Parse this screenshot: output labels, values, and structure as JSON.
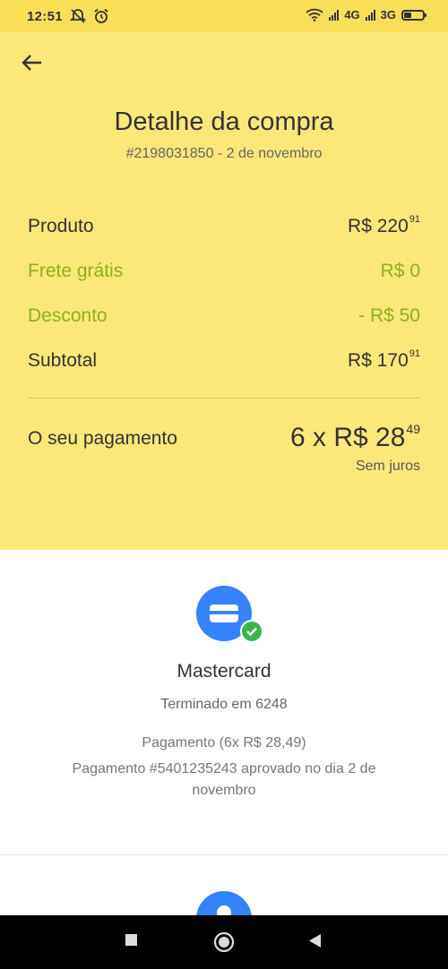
{
  "status_bar": {
    "time": "12:51",
    "network_1": "4G",
    "network_2": "3G",
    "icons": [
      "mute-icon",
      "alarm-icon",
      "wifi-icon",
      "signal-icon",
      "battery-icon"
    ]
  },
  "header": {
    "title": "Detalhe da compra",
    "subtitle": "#2198031850 - 2 de novembro",
    "rows": [
      {
        "label": "Produto",
        "value_main": "R$ 220",
        "value_cents": "91"
      },
      {
        "label": "Frete grátis",
        "value_main": "R$ 0",
        "value_cents": ""
      },
      {
        "label": "Desconto",
        "value_main": "- R$ 50",
        "value_cents": ""
      },
      {
        "label": "Subtotal",
        "value_main": "R$ 170",
        "value_cents": "91"
      }
    ],
    "payment_label": "O seu pagamento",
    "payment_main": "6 x R$ 28",
    "payment_cents": "49",
    "payment_note": "Sem juros"
  },
  "payment_method": {
    "card_name": "Mastercard",
    "card_ending": "Terminado em 6248",
    "installments": "Pagamento (6x R$ 28,49)",
    "approval": "Pagamento #5401235243 aprovado no dia 2 de novembro"
  },
  "colors": {
    "header_bg": "#fbe87a",
    "status_bg": "#f7df58",
    "green": "#8bb31d",
    "blue": "#3483fa",
    "check_green": "#39b54a"
  }
}
